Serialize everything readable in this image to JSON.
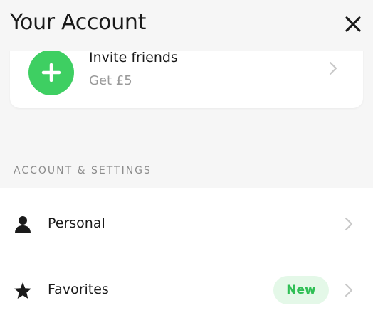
{
  "header": {
    "title": "Your Account",
    "close_icon": "close-icon"
  },
  "invite": {
    "title": "Invite friends",
    "subtitle": "Get £5",
    "icon": "plus-icon",
    "accent": "#3ecf62"
  },
  "section": {
    "label": "ACCOUNT & SETTINGS"
  },
  "rows": [
    {
      "label": "Personal",
      "icon": "person-icon",
      "badge": ""
    },
    {
      "label": "Favorites",
      "icon": "star-icon",
      "badge": "New"
    }
  ],
  "colors": {
    "badge_bg": "#e4f8e8",
    "badge_text": "#2fbf55",
    "background": "#f6f6f6"
  }
}
